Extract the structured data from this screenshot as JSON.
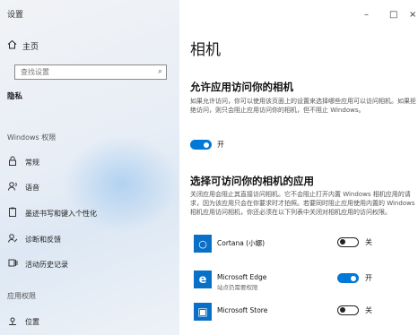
{
  "window": {
    "title": "设置",
    "minimize": "–",
    "maximize": "□",
    "close": "×"
  },
  "sidebar": {
    "home_label": "主页",
    "search_placeholder": "查找设置",
    "category": "隐私",
    "section_windows": "Windows 权限",
    "windows_items": [
      {
        "label": "常规",
        "icon": "lock-icon"
      },
      {
        "label": "语音",
        "icon": "speech-icon"
      },
      {
        "label": "墨迹书写和键入个性化",
        "icon": "clipboard-icon"
      },
      {
        "label": "诊断和反馈",
        "icon": "feedback-icon"
      },
      {
        "label": "活动历史记录",
        "icon": "history-icon"
      }
    ],
    "section_app": "应用权限",
    "app_items": [
      {
        "label": "位置",
        "icon": "location-icon"
      }
    ]
  },
  "main": {
    "title": "相机",
    "allow": {
      "heading": "允许应用访问你的相机",
      "desc": "如果允许访问，你可以使用该页面上的设置来选择哪些应用可以访问相机。如果拒绝访问，则只会阻止应用访问你的相机，但不阻止 Windows。",
      "toggle_state": "on",
      "toggle_label": "开"
    },
    "choose": {
      "heading": "选择可访问你的相机的应用",
      "desc": "关闭应用会阻止其直接访问相机。它不会阻止打开内置 Windows 相机应用的请求，因为该应用只会在你要求时才拍照。若要同时阻止应用使用内置的 Windows 相机应用访问相机，你还必须在以下列表中关闭对相机应用的访问权限。"
    },
    "apps": [
      {
        "name": "Cortana (小娜)",
        "sub": "",
        "state": "off",
        "state_label": "关",
        "icon": "cortana-icon",
        "glyph": "○"
      },
      {
        "name": "Microsoft Edge",
        "sub": "站点仍需要权限",
        "state": "on",
        "state_label": "开",
        "icon": "edge-icon",
        "glyph": "e"
      },
      {
        "name": "Microsoft Store",
        "sub": "",
        "state": "off",
        "state_label": "关",
        "icon": "store-icon",
        "glyph": "▣"
      }
    ]
  },
  "colors": {
    "accent": "#0078d7",
    "tile": "#0a6fc7"
  }
}
